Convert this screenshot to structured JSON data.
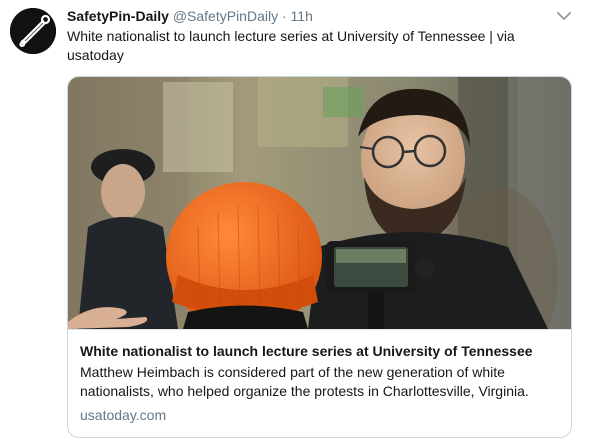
{
  "tweet": {
    "display_name": "SafetyPin-Daily",
    "handle": "@SafetyPinDaily",
    "separator": "·",
    "time": "11h",
    "text": "White nationalist to launch lecture series at University of Tennessee    | via usatoday",
    "avatar_icon": "safety-pin-icon",
    "menu_icon": "chevron-down-icon"
  },
  "card": {
    "image_alt": "man with beard and glasses speaking to person in orange beanie",
    "title": "White nationalist to launch lecture series at University of Tennessee",
    "description": "Matthew Heimbach is considered part of the new generation of white nationalists, who helped organize the protests in Charlottesville, Virginia.",
    "domain": "usatoday.com"
  },
  "colors": {
    "text_primary": "#14171a",
    "text_secondary": "#657786",
    "card_border": "#ccd6dd",
    "beanie_orange": "#f26a1b"
  }
}
